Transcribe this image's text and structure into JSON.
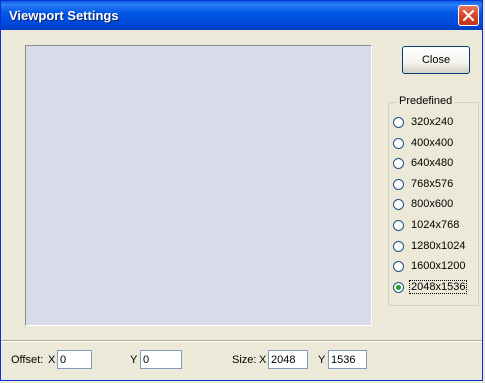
{
  "window": {
    "title": "Viewport Settings"
  },
  "buttons": {
    "close_label": "Close"
  },
  "predefined": {
    "label": "Predefined",
    "options": [
      "320x240",
      "400x400",
      "640x480",
      "768x576",
      "800x600",
      "1024x768",
      "1280x1024",
      "1600x1200",
      "2048x1536"
    ],
    "selected": "2048x1536"
  },
  "offset": {
    "label": "Offset:",
    "x_label": "X",
    "x_value": "0",
    "y_label": "Y",
    "y_value": "0"
  },
  "size": {
    "label": "Size:",
    "x_label": "X",
    "x_value": "2048",
    "y_label": "Y",
    "y_value": "1536"
  },
  "colors": {
    "title_bar": "#0058e6",
    "viewport_bg": "#d8dbe8",
    "dialog_bg": "#ece9d8",
    "close_red": "#d7462a",
    "radio_dot": "#21a121"
  }
}
